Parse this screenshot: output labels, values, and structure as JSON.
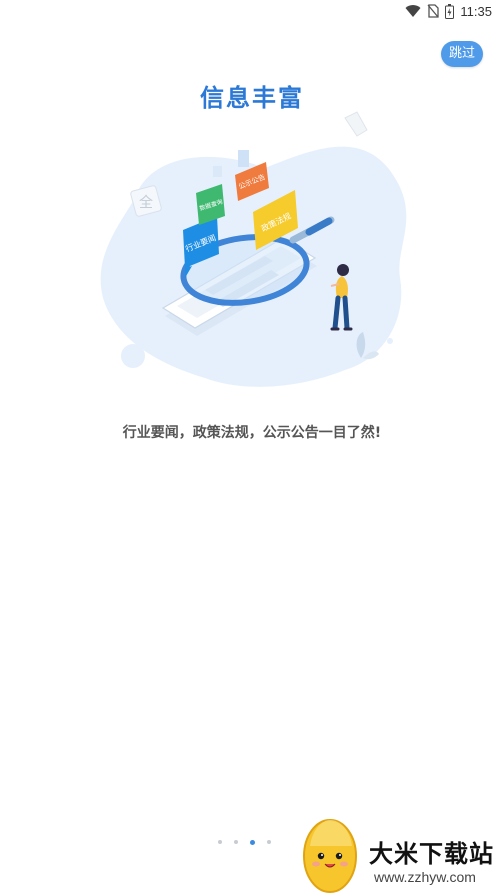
{
  "status_bar": {
    "time": "11:35",
    "icons": [
      "wifi-icon",
      "sim-off-icon",
      "battery-icon"
    ]
  },
  "header": {
    "skip_label": "跳过"
  },
  "main": {
    "title": "信息丰富",
    "subtitle": "行业要闻，政策法规，公示公告一目了然!",
    "illustration": {
      "tags": [
        "行业要闻",
        "数据查询",
        "公示公告",
        "政策法规"
      ],
      "glyph": "全"
    }
  },
  "pager": {
    "total": 4,
    "active_index": 2
  },
  "watermark": {
    "name": "大米下载站",
    "url": "www.zzhyw.com"
  },
  "colors": {
    "accent": "#2b78d6",
    "skip_button": "#4f9bea",
    "tag_blue": "#1e8ee5",
    "tag_green": "#3fb970",
    "tag_orange": "#f07b3f",
    "tag_yellow": "#f6cb2c"
  }
}
